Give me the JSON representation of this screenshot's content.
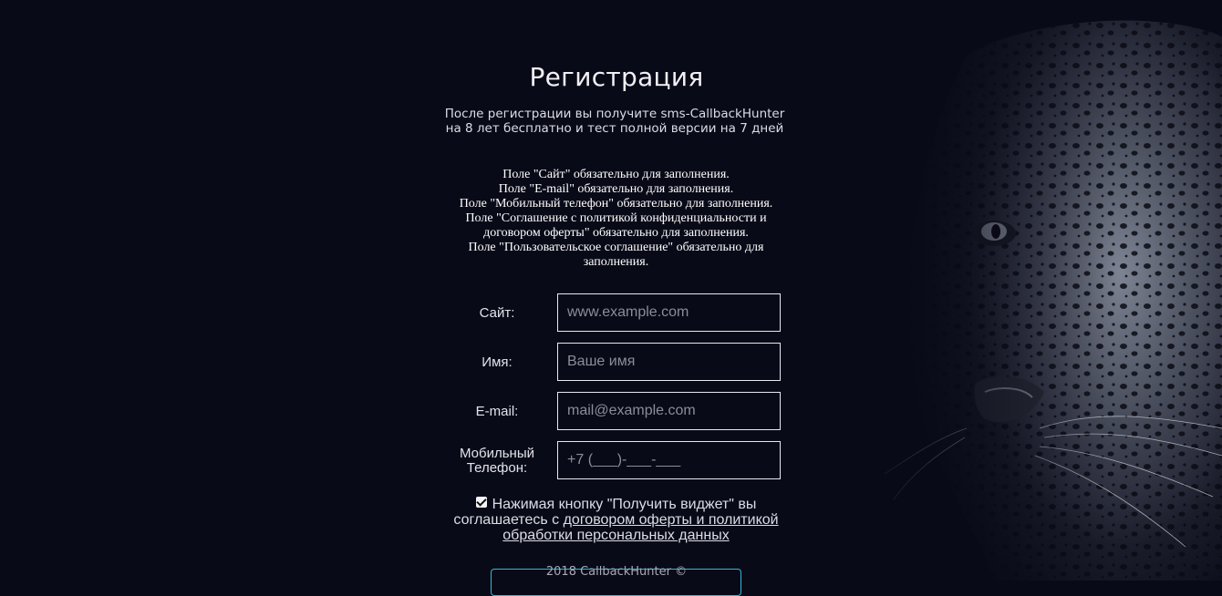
{
  "page": {
    "title": "Регистрация",
    "subtitle_line1": "После регистрации вы получите sms-CallbackHunter",
    "subtitle_line2": "на 8 лет бесплатно и тест полной версии на 7 дней"
  },
  "errors": [
    "Поле \"Сайт\" обязательно для заполнения.",
    "Поле \"E-mail\" обязательно для заполнения.",
    "Поле \"Мобильный телефон\" обязательно для заполнения.",
    "Поле \"Соглашение с политикой конфиденциальности и договором оферты\" обязательно для заполнения.",
    "Поле \"Пользовательское соглашение\" обязательно для заполнения."
  ],
  "form": {
    "site": {
      "label": "Сайт:",
      "placeholder": "www.example.com",
      "value": ""
    },
    "name": {
      "label": "Имя:",
      "placeholder": "Ваше имя",
      "value": ""
    },
    "email": {
      "label": "E-mail:",
      "placeholder": "mail@example.com",
      "value": ""
    },
    "phone": {
      "label_line1": "Мобильный",
      "label_line2": "Телефон:",
      "placeholder": "+7 (___)-___-___",
      "value": ""
    }
  },
  "agreement": {
    "checked": true,
    "text": "Нажимая кнопку \"Получить виджет\" вы соглашаетесь с ",
    "link_text": "договором оферты и политикой обработки персональных данных"
  },
  "footer": {
    "copyright": "2018 CallbackHunter ©"
  },
  "colors": {
    "background": "#090a18",
    "accent": "#35b8d4",
    "text": "#e8e8ee"
  },
  "icons": {
    "checkbox": "checkmark-icon"
  }
}
